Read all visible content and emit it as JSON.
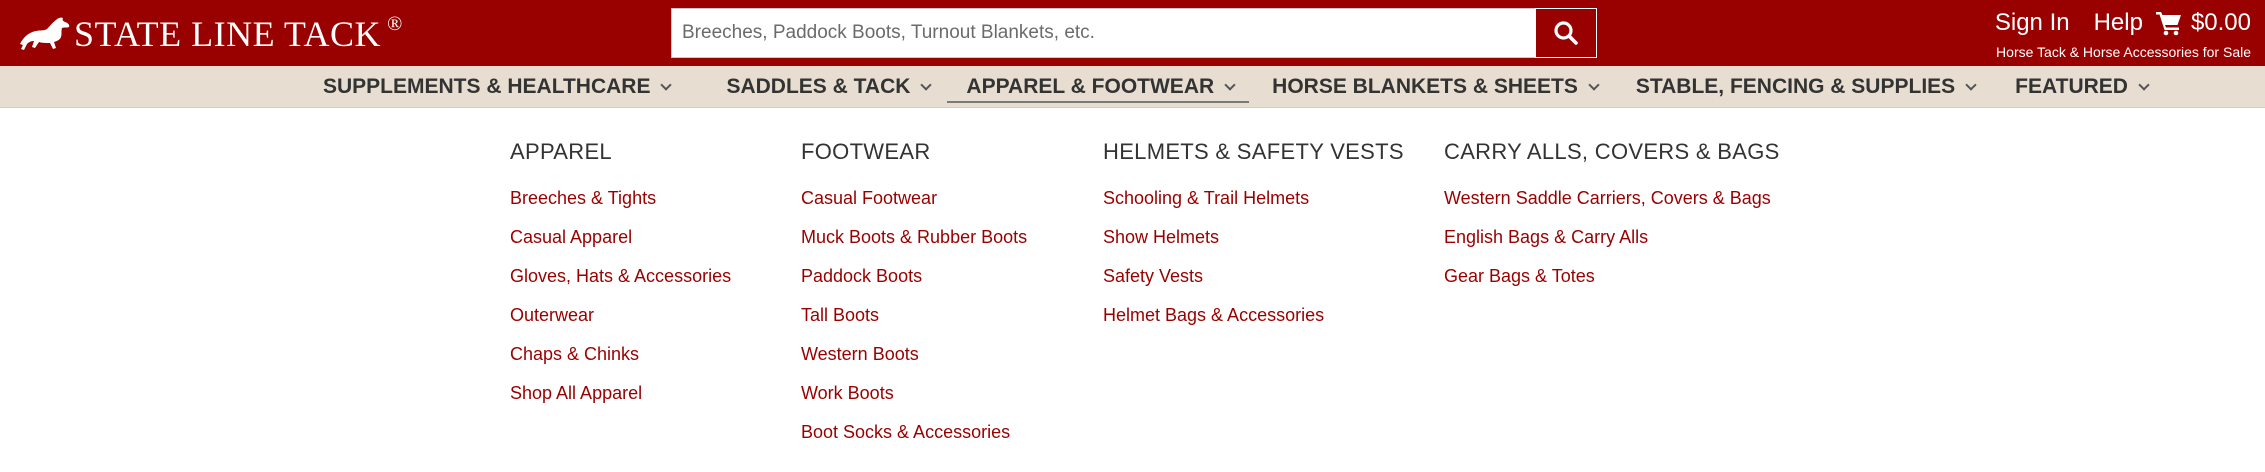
{
  "brand": {
    "name": "STATE LINE TACK",
    "reg_mark": "®",
    "logo_icon": "horse-icon"
  },
  "search": {
    "placeholder": "Breeches, Paddock Boots, Turnout Blankets, etc.",
    "icon": "search-icon"
  },
  "account": {
    "signin_label": "Sign In",
    "help_label": "Help",
    "cart_total": "$0.00",
    "cart_icon": "cart-icon",
    "tagline": "Horse Tack & Horse Accessories for Sale"
  },
  "nav": {
    "items": [
      {
        "label": "SUPPLEMENTS & HEALTHCARE"
      },
      {
        "label": "SADDLES & TACK"
      },
      {
        "label": "APPAREL & FOOTWEAR",
        "active": true
      },
      {
        "label": "HORSE BLANKETS & SHEETS"
      },
      {
        "label": "STABLE, FENCING & SUPPLIES"
      },
      {
        "label": "FEATURED"
      }
    ]
  },
  "menu": {
    "columns": [
      {
        "title": "APPAREL",
        "links": [
          "Breeches & Tights",
          "Casual Apparel",
          "Gloves, Hats & Accessories",
          "Outerwear",
          "Chaps & Chinks",
          "Shop All Apparel"
        ]
      },
      {
        "title": "FOOTWEAR",
        "links": [
          "Casual Footwear",
          "Muck Boots & Rubber Boots",
          "Paddock Boots",
          "Tall Boots",
          "Western Boots",
          "Work Boots",
          "Boot Socks & Accessories"
        ]
      },
      {
        "title": "HELMETS & SAFETY VESTS",
        "links": [
          "Schooling & Trail Helmets",
          "Show Helmets",
          "Safety Vests",
          "Helmet Bags & Accessories"
        ]
      },
      {
        "title": "CARRY ALLS, COVERS & BAGS",
        "links": [
          "Western Saddle Carriers, Covers & Bags",
          "English Bags & Carry Alls",
          "Gear Bags & Totes"
        ]
      }
    ]
  },
  "colors": {
    "brand_red": "#990000",
    "nav_bg": "#e8ddd1",
    "link": "#990000"
  }
}
